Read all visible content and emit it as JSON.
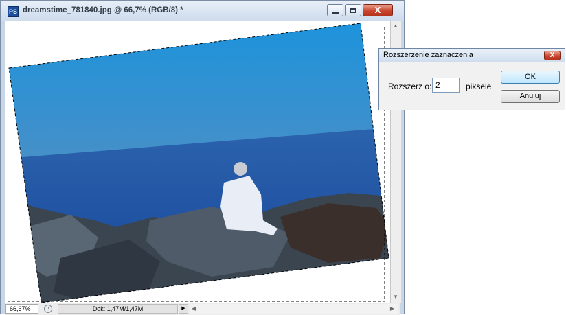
{
  "document_window": {
    "app_icon": "PS",
    "title": "dreamstime_781840.jpg @ 66,7% (RGB/8) *",
    "controls": {
      "minimize_icon": "minimize-icon",
      "maximize_icon": "maximize-icon",
      "close_label": "X"
    }
  },
  "status_bar": {
    "zoom": "66,67%",
    "doc_info": "Dok: 1,47M/1,47M",
    "menu_arrow": "▶"
  },
  "dialog": {
    "title": "Rozszerzenie zaznaczenia",
    "close_label": "X",
    "field_label": "Rozszerz o:",
    "field_value": "2",
    "field_unit": "piksele",
    "ok_label": "OK",
    "cancel_label": "Anuluj"
  },
  "colors": {
    "sky_top": "#1e8fd6",
    "sea": "#1a4ea6",
    "rocks": "#3d4852",
    "dialog_bg": "#f1f1f1",
    "close_button": "#c9452e"
  }
}
